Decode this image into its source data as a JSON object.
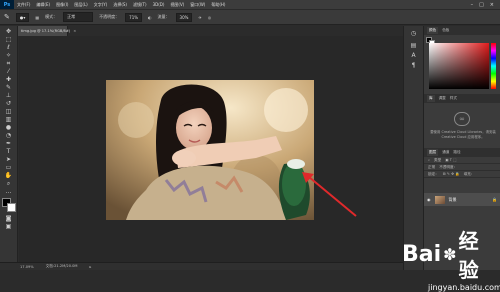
{
  "app": {
    "logo": "Ps"
  },
  "menu": [
    "文件(F)",
    "编辑(E)",
    "图像(I)",
    "图层(L)",
    "文字(Y)",
    "选择(S)",
    "滤镜(T)",
    "3D(D)",
    "视图(V)",
    "窗口(W)",
    "帮助(H)"
  ],
  "window_controls": [
    "–",
    "□",
    "×"
  ],
  "options_bar": {
    "mode_label": "模式：",
    "mode_value": "正常",
    "opacity_label": "不透明度：",
    "opacity_value": "71%",
    "flow_label": "流量：",
    "flow_value": "30%"
  },
  "document_tab": {
    "title": "timg.jpg @ 17.1%(RGB/8#)",
    "close": "×"
  },
  "status": {
    "zoom": "17.09%",
    "doc": "文档:21.2M/20.0M"
  },
  "panels": {
    "top_tabs": [
      "颜色",
      "色板"
    ],
    "mid_tabs": [
      "库",
      "调整",
      "样式"
    ],
    "cc_text": "要使用 Creative Cloud Libraries，请安装 Creative Cloud 应用程序。",
    "layers_tabs": [
      "图层",
      "通道",
      "路径"
    ],
    "layer_kind": "类型",
    "blend": "正常",
    "opacity_label": "不透明度：",
    "lock_label": "锁定：",
    "fill_label": "填充：",
    "layer_name": "背景"
  },
  "watermark": {
    "brand": "Bai",
    "brand2": "经验",
    "url": "jingyan.baidu.com"
  },
  "colors": {
    "arrow": "#e0292b",
    "accent": "#31a8ff"
  }
}
